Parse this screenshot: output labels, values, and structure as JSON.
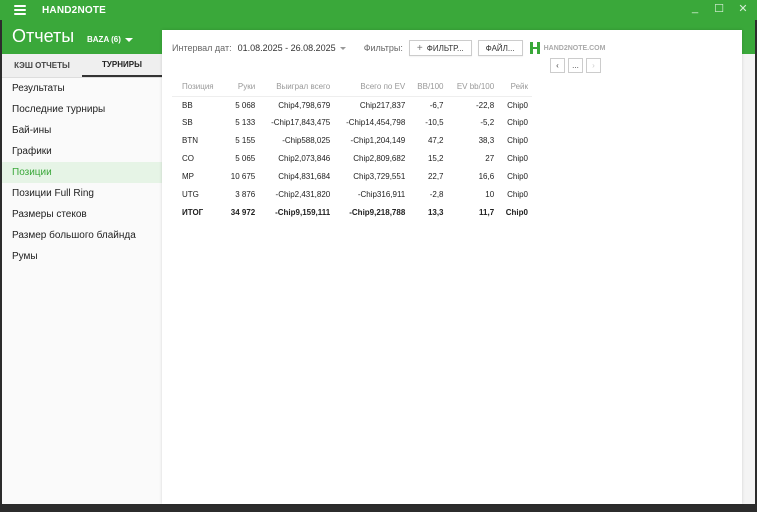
{
  "window": {
    "app_name": "HAND2NOTE",
    "controls": {
      "minimize": "_",
      "maximize": "☐",
      "close": "✕"
    }
  },
  "header": {
    "title": "Отчеты",
    "database": "BAZA (6)"
  },
  "tabs": [
    {
      "label": "КЭШ ОТЧЕТЫ",
      "active": false
    },
    {
      "label": "ТУРНИРЫ",
      "active": true
    }
  ],
  "sidebar": {
    "items": [
      {
        "label": "Результаты"
      },
      {
        "label": "Последние турниры"
      },
      {
        "label": "Бай-ины"
      },
      {
        "label": "Графики"
      },
      {
        "label": "Позиции",
        "active": true
      },
      {
        "label": "Позиции Full Ring"
      },
      {
        "label": "Размеры стеков"
      },
      {
        "label": "Размер большого блайнда"
      },
      {
        "label": "Румы"
      }
    ]
  },
  "toolbar": {
    "interval_label": "Интервал дат:",
    "date_range": "01.08.2025 - 26.08.2025",
    "filters_label": "Фильтры:",
    "filter_button": "ФИЛЬТР...",
    "file_button": "ФАЙЛ...",
    "logo_text": "HAND2NOTE.COM"
  },
  "pager": {
    "prev": "‹",
    "more": "...",
    "next": "›"
  },
  "table": {
    "columns": [
      "Позиция",
      "Руки",
      "Выиграл всего",
      "Всего по EV",
      "BB/100",
      "EV bb/100",
      "Рейк"
    ],
    "rows": [
      {
        "pos": "BB",
        "hands": "5 068",
        "won": "Chip4,798,679",
        "ev": "Chip217,837",
        "bb": "-6,7",
        "evbb": "-22,8",
        "rake": "Chip0",
        "won_neg": false,
        "ev_neg": false,
        "bb_neg": true,
        "evbb_neg": true
      },
      {
        "pos": "SB",
        "hands": "5 133",
        "won": "-Chip17,843,475",
        "ev": "-Chip14,454,798",
        "bb": "-10,5",
        "evbb": "-5,2",
        "rake": "Chip0",
        "won_neg": true,
        "ev_neg": true,
        "bb_neg": true,
        "evbb_neg": true
      },
      {
        "pos": "BTN",
        "hands": "5 155",
        "won": "-Chip588,025",
        "ev": "-Chip1,204,149",
        "bb": "47,2",
        "evbb": "38,3",
        "rake": "Chip0",
        "won_neg": true,
        "ev_neg": true,
        "bb_neg": false,
        "evbb_neg": false
      },
      {
        "pos": "CO",
        "hands": "5 065",
        "won": "Chip2,073,846",
        "ev": "Chip2,809,682",
        "bb": "15,2",
        "evbb": "27",
        "rake": "Chip0",
        "won_neg": false,
        "ev_neg": false,
        "bb_neg": false,
        "evbb_neg": false
      },
      {
        "pos": "MP",
        "hands": "10 675",
        "won": "Chip4,831,684",
        "ev": "Chip3,729,551",
        "bb": "22,7",
        "evbb": "16,6",
        "rake": "Chip0",
        "won_neg": false,
        "ev_neg": false,
        "bb_neg": false,
        "evbb_neg": false
      },
      {
        "pos": "UTG",
        "hands": "3 876",
        "won": "-Chip2,431,820",
        "ev": "-Chip316,911",
        "bb": "-2,8",
        "evbb": "10",
        "rake": "Chip0",
        "won_neg": true,
        "ev_neg": true,
        "bb_neg": true,
        "evbb_neg": false
      }
    ],
    "total": {
      "pos": "ИТОГ",
      "hands": "34 972",
      "won": "-Chip9,159,111",
      "ev": "-Chip9,218,788",
      "bb": "13,3",
      "evbb": "11,7",
      "rake": "Chip0",
      "won_neg": true,
      "ev_neg": true,
      "bb_neg": false,
      "evbb_neg": false
    }
  },
  "colors": {
    "brand": "#3aa83a",
    "positive": "#4cae3f",
    "negative": "#d64a2f"
  }
}
